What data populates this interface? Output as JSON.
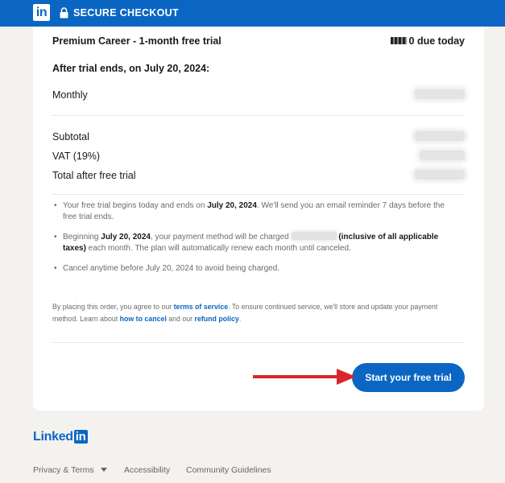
{
  "header": {
    "brand": "in",
    "secure_label": "SECURE CHECKOUT"
  },
  "plan": {
    "name": "Premium Career - 1-month free trial",
    "due_today": "0 due today"
  },
  "trial_end_heading": "After trial ends, on July 20, 2024:",
  "line_items": {
    "monthly": "Monthly",
    "subtotal": "Subtotal",
    "vat": "VAT (19%)",
    "total": "Total after free trial"
  },
  "notes": {
    "n1_a": "Your free trial begins today and ends on ",
    "n1_date": "July 20, 2024",
    "n1_b": ". We'll send you an email reminder 7 days before the free trial ends.",
    "n2_a": "Beginning ",
    "n2_date": "July 20, 2024",
    "n2_b": ", your payment method will be charged ",
    "n2_incl": "(inclusive of all applicable taxes)",
    "n2_c": " each month. The plan will automatically renew each month until canceled.",
    "n3": "Cancel anytime before July 20, 2024 to avoid being charged."
  },
  "terms": {
    "t1": "By placing this order, you agree to our ",
    "tos": "terms of service",
    "t2": ". To ensure continued service, we'll store and update your payment method. Learn about ",
    "cancel": "how to cancel",
    "t3": " and our ",
    "refund": "refund policy",
    "t4": "."
  },
  "cta_label": "Start your free trial",
  "footer": {
    "logo_text": "Linked",
    "logo_in": "in",
    "links": [
      "Privacy & Terms",
      "Accessibility",
      "Community Guidelines"
    ]
  },
  "colors": {
    "brand": "#0a66c2",
    "arrow": "#d8262b"
  }
}
